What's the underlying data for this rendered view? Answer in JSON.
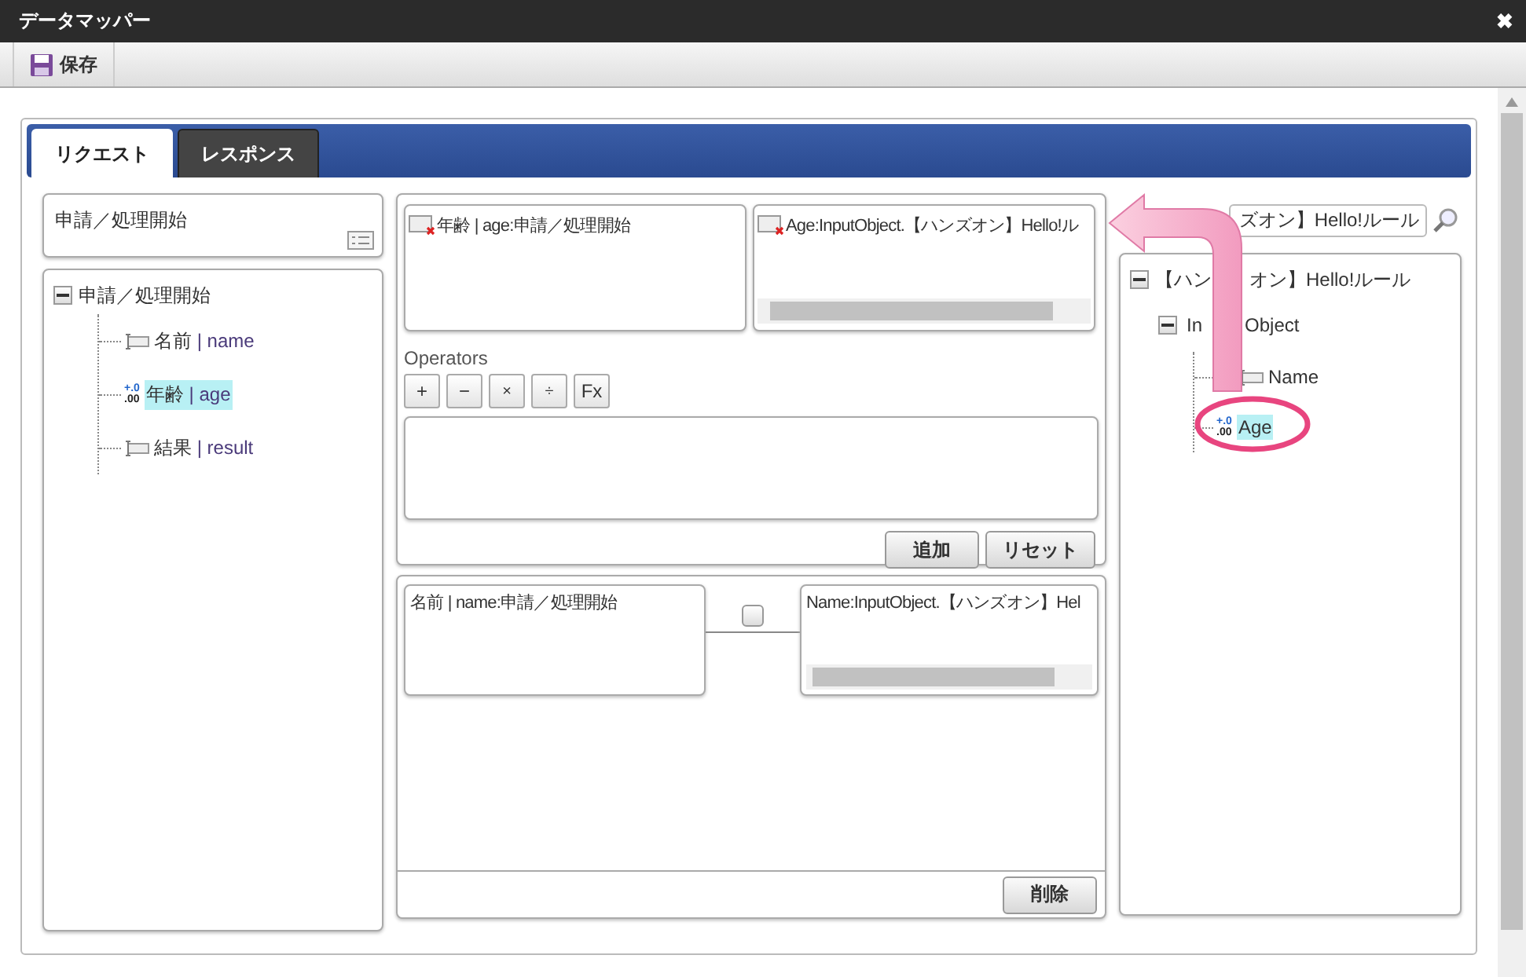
{
  "window": {
    "title": "データマッパー",
    "close": "✖"
  },
  "toolbar": {
    "buttons": [
      {
        "label": "保存"
      }
    ]
  },
  "tabs": [
    {
      "label": "リクエスト",
      "selected": true
    },
    {
      "label": "レスポンス",
      "selected": false
    }
  ],
  "source": {
    "header": "申請／処理開始",
    "tree": {
      "label": "申請／処理開始",
      "expanded": true,
      "children": [
        {
          "label": "名前",
          "field": "| name",
          "kind": "text",
          "selected": false
        },
        {
          "label": "年齢",
          "field": "| age",
          "kind": "number",
          "icon": [
            "+.0",
            ".00"
          ],
          "selected": true
        },
        {
          "label": "結果",
          "field": "| result",
          "kind": "text",
          "selected": false
        }
      ]
    }
  },
  "formula": {
    "left": "年齢 | age:申請／処理開始",
    "right": "Age:InputObject.【ハンズオン】Hello!ル",
    "operators_label": "Operators",
    "operators": [
      "+",
      "−",
      "×",
      "÷",
      "Fx"
    ],
    "buttons": [
      "追加",
      "リセット"
    ]
  },
  "mappings": [
    {
      "source": "名前 | name:申請／処理開始",
      "target": "Name:InputObject.【ハンズオン】Hel",
      "checked": false
    }
  ],
  "delete_button": "削除",
  "target": {
    "search": {
      "value": "ズオン】Hello!ルール"
    },
    "tree": {
      "parts": [
        "【ハン",
        "オン】Hello!ルール"
      ],
      "expanded": true,
      "children": [
        {
          "parts": [
            "In",
            "Object"
          ],
          "expanded": true,
          "children": [
            {
              "label": "Name",
              "kind": "text",
              "selected": false
            },
            {
              "label": "Age",
              "kind": "number",
              "icon": [
                "+.0",
                ".00"
              ],
              "selected": true
            }
          ]
        }
      ]
    }
  }
}
